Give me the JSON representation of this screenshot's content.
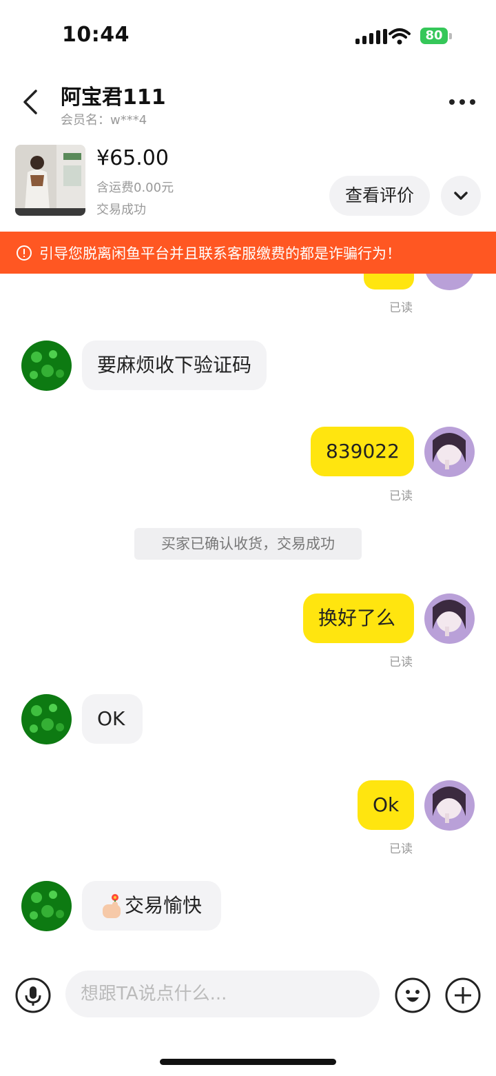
{
  "status_bar": {
    "time": "10:44",
    "battery": "80"
  },
  "header": {
    "title": "阿宝君111",
    "member_label": "会员名：w***4"
  },
  "product": {
    "price": "¥65.00",
    "shipping": "含运费0.00元",
    "status": "交易成功",
    "review_button": "查看评价"
  },
  "warning_banner": {
    "text": "引导您脱离闲鱼平台并且联系客服缴费的都是诈骗行为！",
    "color": "#ff5722"
  },
  "messages": {
    "m0_read": "已读",
    "m1_text": "要麻烦收下验证码",
    "m2_text": "839022",
    "m2_read": "已读",
    "system_text": "买家已确认收货，交易成功",
    "m3_text": "换好了么",
    "m3_read": "已读",
    "m4_text": "OK",
    "m5_text": "Ok",
    "m5_read": "已读",
    "m6_text": "交易愉快"
  },
  "input": {
    "placeholder": "想跟TA说点什么..."
  },
  "colors": {
    "my_bubble": "#ffe50f",
    "their_bubble": "#f3f3f5",
    "banner": "#ff5722",
    "battery": "#35c759"
  },
  "icons": [
    "back-icon",
    "more-icon",
    "chevron-down-icon",
    "warning-icon",
    "microphone-icon",
    "emoji-icon",
    "plus-icon",
    "finger-flower-emoji"
  ]
}
